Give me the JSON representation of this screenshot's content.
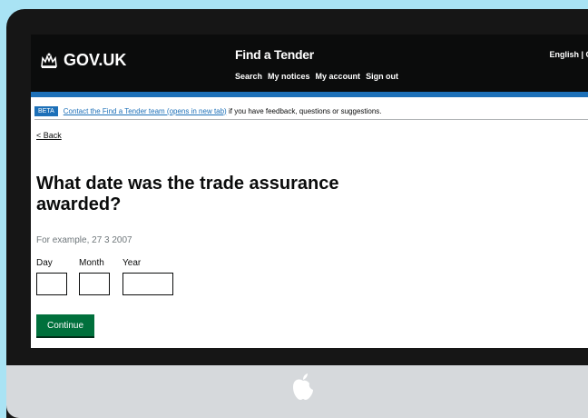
{
  "header": {
    "logo_text": "GOV.UK",
    "service_name": "Find a Tender",
    "nav": [
      "Search",
      "My notices",
      "My account",
      "Sign out"
    ],
    "language": "English | C"
  },
  "phase_banner": {
    "tag": "BETA",
    "link_text": "Contact the Find a Tender team (opens in new tab)",
    "text": "if you have feedback, questions or suggestions."
  },
  "back_link": "< Back",
  "question": "What date was the trade assurance awarded?",
  "hint": "For example, 27 3 2007",
  "date_fields": {
    "day_label": "Day",
    "month_label": "Month",
    "year_label": "Year"
  },
  "continue_label": "Continue",
  "colors": {
    "background": "#a9e3f4",
    "header": "#0b0c0c",
    "accent_blue": "#1d70b8",
    "button_green": "#00703c"
  },
  "icons": [
    "crown-icon",
    "apple-logo-icon"
  ]
}
